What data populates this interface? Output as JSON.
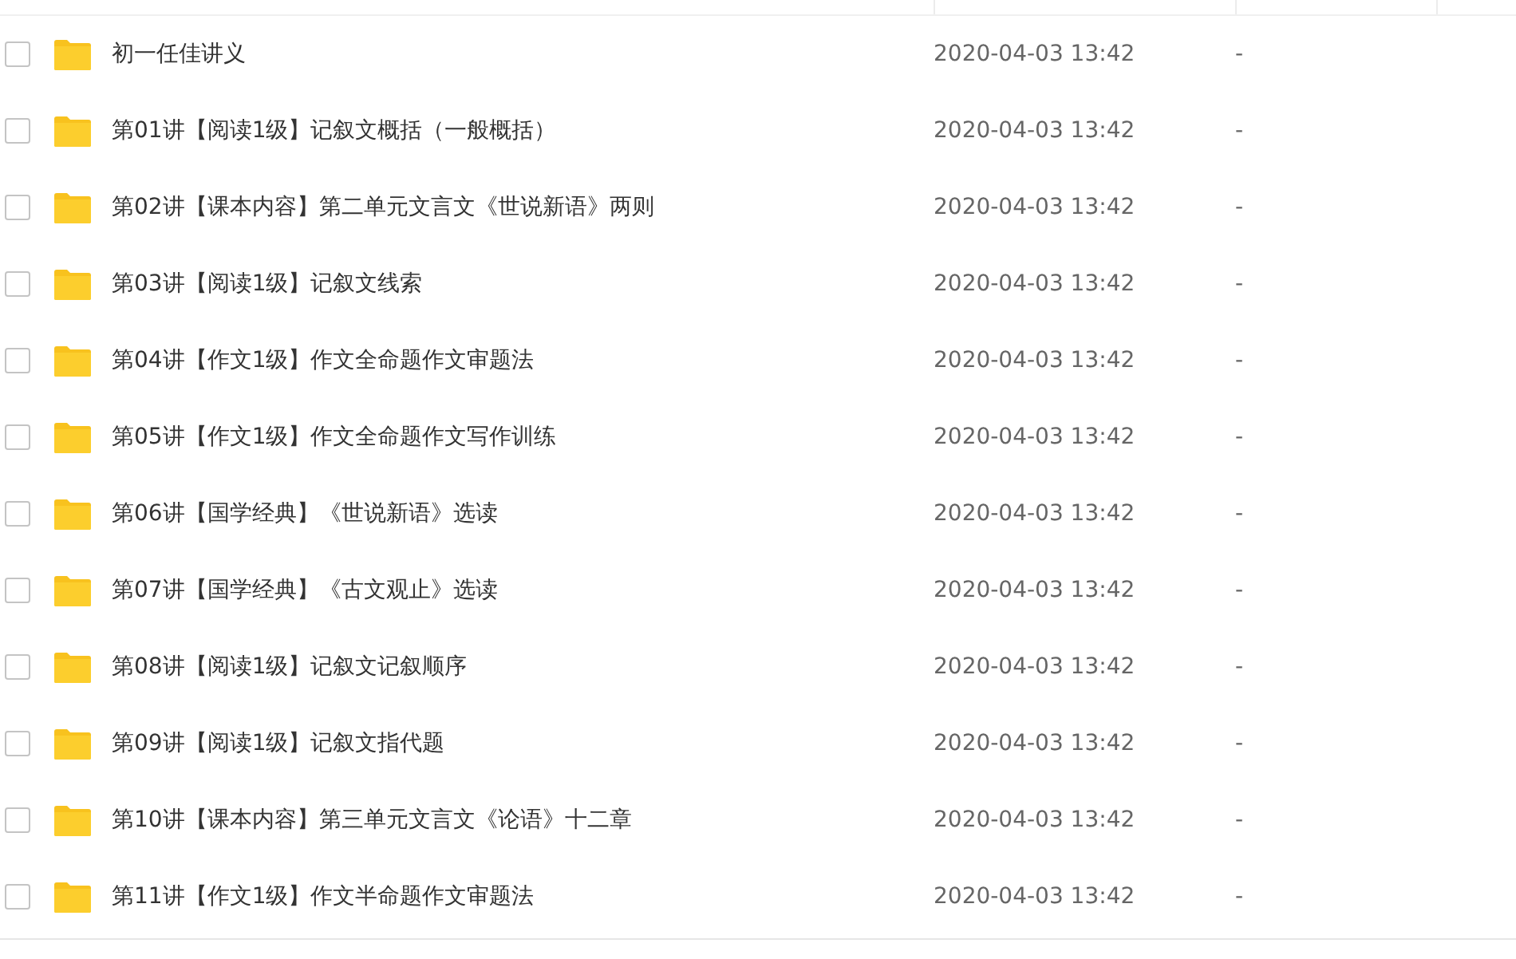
{
  "rows": [
    {
      "name": "初一任佳讲义",
      "modified": "2020-04-03 13:42",
      "size": "-",
      "checked": false
    },
    {
      "name": "第01讲【阅读1级】记叙文概括（一般概括）",
      "modified": "2020-04-03 13:42",
      "size": "-",
      "checked": false
    },
    {
      "name": "第02讲【课本内容】第二单元文言文《世说新语》两则",
      "modified": "2020-04-03 13:42",
      "size": "-",
      "checked": false
    },
    {
      "name": "第03讲【阅读1级】记叙文线索",
      "modified": "2020-04-03 13:42",
      "size": "-",
      "checked": false
    },
    {
      "name": "第04讲【作文1级】作文全命题作文审题法",
      "modified": "2020-04-03 13:42",
      "size": "-",
      "checked": false
    },
    {
      "name": "第05讲【作文1级】作文全命题作文写作训练",
      "modified": "2020-04-03 13:42",
      "size": "-",
      "checked": false
    },
    {
      "name": "第06讲【国学经典】《世说新语》选读",
      "modified": "2020-04-03 13:42",
      "size": "-",
      "checked": false
    },
    {
      "name": "第07讲【国学经典】《古文观止》选读",
      "modified": "2020-04-03 13:42",
      "size": "-",
      "checked": false
    },
    {
      "name": "第08讲【阅读1级】记叙文记叙顺序",
      "modified": "2020-04-03 13:42",
      "size": "-",
      "checked": false
    },
    {
      "name": "第09讲【阅读1级】记叙文指代题",
      "modified": "2020-04-03 13:42",
      "size": "-",
      "checked": false
    },
    {
      "name": "第10讲【课本内容】第三单元文言文《论语》十二章",
      "modified": "2020-04-03 13:42",
      "size": "-",
      "checked": false
    },
    {
      "name": "第11讲【作文1级】作文半命题作文审题法",
      "modified": "2020-04-03 13:42",
      "size": "-",
      "checked": false
    }
  ]
}
